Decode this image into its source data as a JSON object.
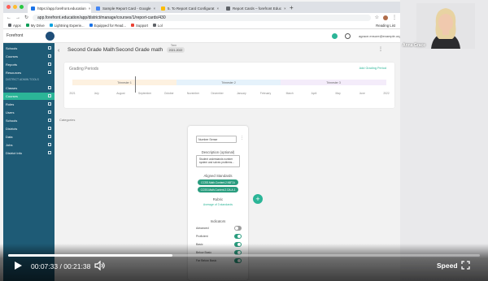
{
  "browser": {
    "tabs": [
      {
        "label": "https://app.forefront.education",
        "color": "#1a73e8",
        "active": true
      },
      {
        "label": "Sample Report Card - Google",
        "color": "#4285f4",
        "active": false
      },
      {
        "label": "5. To Report Card Configurat",
        "color": "#fbbc04",
        "active": false
      },
      {
        "label": "Report Cards – forefront Educ",
        "color": "#5f6368",
        "active": false
      }
    ],
    "url": "app.forefront.education/app/district/manage/courses/1/report-cards/430",
    "bookmarks": [
      {
        "label": "Apps",
        "color": "#5f6368"
      },
      {
        "label": "My Drive",
        "color": "#0f9d58"
      },
      {
        "label": "Lightning Experie...",
        "color": "#00a1e0"
      },
      {
        "label": "Equipped for Read...",
        "color": "#1a73e8"
      },
      {
        "label": "Support",
        "color": "#ea4335"
      },
      {
        "label": "Lol",
        "color": "#5f6368"
      }
    ],
    "reading_list": "Reading List"
  },
  "app": {
    "brand": "Forefront",
    "email": "agrace.ensure@example.org"
  },
  "sidebar": {
    "items_top": [
      {
        "label": "Schools"
      },
      {
        "label": "Courses"
      },
      {
        "label": "Reports"
      },
      {
        "label": "Resources"
      }
    ],
    "section_label": "DISTRICT ADMIN TOOLS",
    "items_bottom": [
      {
        "label": "Classes",
        "active": false
      },
      {
        "label": "Courses",
        "active": true
      },
      {
        "label": "Roles",
        "active": false
      },
      {
        "label": "Users",
        "active": false
      },
      {
        "label": "Schools",
        "active": false
      },
      {
        "label": "Districts",
        "active": false
      },
      {
        "label": "Data",
        "active": false
      },
      {
        "label": "Jobs",
        "active": false
      },
      {
        "label": "District Info",
        "active": false
      }
    ]
  },
  "page": {
    "crumb": "Second Grade Math",
    "title": "Second Grade math",
    "term_label": "Term",
    "term": "2021-2022"
  },
  "grading": {
    "title": "Grading Periods",
    "add": "Add Grading Period",
    "trimesters": [
      "Trimester 1",
      "Trimester 2",
      "Trimester 3"
    ],
    "months": [
      "2021",
      "July",
      "August",
      "September",
      "October",
      "November",
      "December",
      "January",
      "February",
      "March",
      "April",
      "May",
      "June",
      "2022"
    ]
  },
  "categories_label": "Categories",
  "category": {
    "select_value": "Number Sense",
    "description_label": "Description (optional)",
    "description": "Student understands number system and solves problems...",
    "aligned_label": "Aligned Standards",
    "standards": [
      "CCSS.Math.Content.2.NBT.A",
      "CCSS.Math.Content.2.OA.A.1"
    ],
    "rubric_label": "Rubric",
    "rubric_value": "Average of 3 standards",
    "indicators_label": "Indicators",
    "indicators": [
      {
        "label": "Advanced",
        "on": false
      },
      {
        "label": "Proficient",
        "on": true
      },
      {
        "label": "Basic",
        "on": true
      },
      {
        "label": "Below Basic",
        "on": true
      },
      {
        "label": "Far Below Basic",
        "on": true
      }
    ]
  },
  "webcam": {
    "name": "Anna Grace"
  },
  "player": {
    "current": "00:07:33",
    "separator": "/",
    "duration": "00:21:38",
    "progress": 0.349,
    "speed_label": "Speed"
  }
}
